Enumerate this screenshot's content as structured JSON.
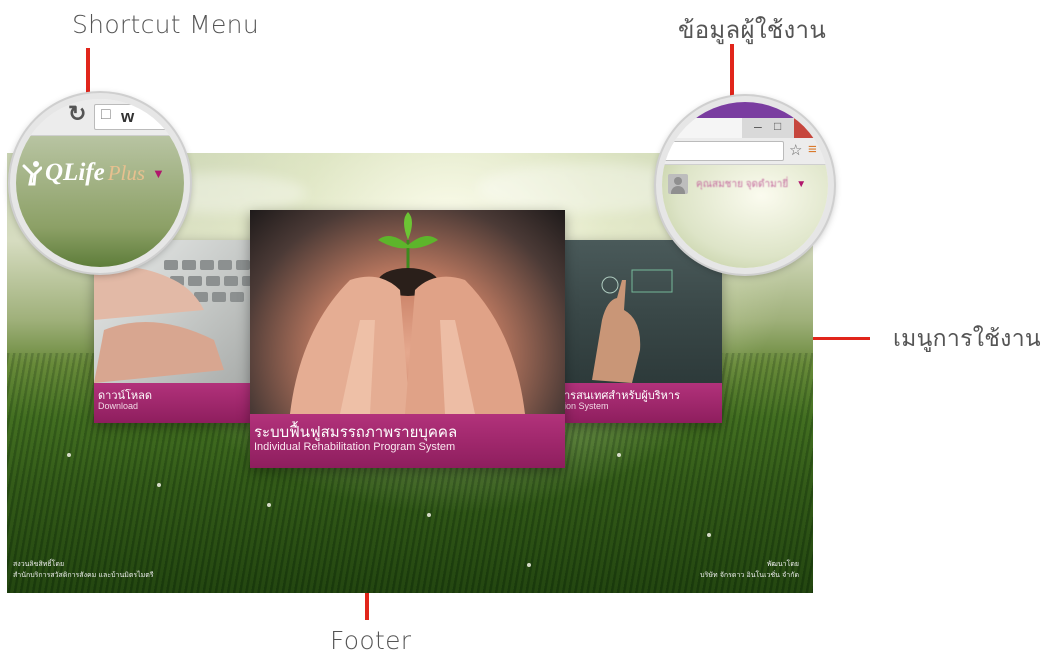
{
  "annotations": {
    "shortcut_menu": "Shortcut Menu",
    "user_info": "ข้อมูลผู้ใช้งาน",
    "usage_menu": "เมนูการใช้งาน",
    "footer": "Footer"
  },
  "logo": {
    "q_life": "QLife",
    "plus": "Plus"
  },
  "browser": {
    "url_prefix": "w"
  },
  "user_menu": {
    "name": "คุณสมชาย จุดดำมายี่"
  },
  "cards": {
    "download": {
      "title": "ดาวน์โหลด",
      "subtitle": "Download"
    },
    "main": {
      "title": "ระบบฟื้นฟูสมรรถภาพรายบุคคล",
      "subtitle": "Individual Rehabilitation Program System"
    },
    "executive": {
      "title": "ารสนเทศสำหรับผู้บริหาร",
      "subtitle": "ion System"
    }
  },
  "footer": {
    "left_line1": "สงวนลิขสิทธิ์โดย",
    "left_line2": "สำนักบริการสวัสดิการสังคม และบ้านมิตรไมตรี",
    "right_line1": "พัฒนาโดย",
    "right_line2": "บริษัท จักรดาว อินโนเวชั่น จำกัด"
  },
  "colors": {
    "accent": "#a3226b",
    "pointer": "#e1251b"
  }
}
